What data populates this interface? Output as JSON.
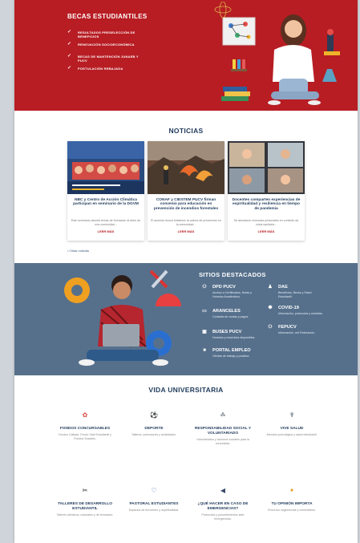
{
  "hero": {
    "title": "BECAS ESTUDIANTILES",
    "items": [
      "RESULTADOS PRESELECCIÓN DE BENEFICIOS",
      "RENOVACIÓN SOCIOECONÓMICA",
      "BECAS DE MANTENCIÓN JUNAEB Y PUCV",
      "POSTULACIÓN REBAJADA"
    ],
    "check_icon": "check-icon"
  },
  "news": {
    "title": "NOTICIAS",
    "cards": [
      {
        "title": "NBC y Centro de Acción Climática participan en seminario de la DGVM",
        "desc": "Este seminario abordó temas de formación al alero de una comunidad...",
        "more": "LEER MÁS"
      },
      {
        "title": "CONAF y CIESTEM PUCV firman convenio para educación en prevención de incendios forestales",
        "desc": "El acuerdo busca fortalecer la cultura de prevención en la comunidad...",
        "more": "LEER MÁS"
      },
      {
        "title": "Docentes comparten experiencias de espiritualidad y resiliencia en tiempo de pandemia",
        "desc": "Se abordaron vivencias personales en contexto de crisis sanitaria...",
        "more": "LEER MÁS"
      }
    ],
    "all_link": "• Otras noticias"
  },
  "sitios": {
    "title": "SITIOS DESTACADOS",
    "left": [
      {
        "icon": "users-icon",
        "label": "DPD PUCV",
        "desc": "Acceso a Certificados, Notas y Horarios Académicos."
      },
      {
        "icon": "card-icon",
        "label": "ARANCELES",
        "desc": "Consulta de cuotas y pagos."
      },
      {
        "icon": "bus-icon",
        "label": "BUSES PUCV",
        "desc": "Horarios y recorridos disponibles."
      },
      {
        "icon": "briefcase-icon",
        "label": "PORTAL EMPLEO",
        "desc": "Ofertas de trabajo y práctica."
      }
    ],
    "right": [
      {
        "icon": "user-icon",
        "label": "DAE",
        "desc": "Beneficios, Becas y Salud Estudiantil."
      },
      {
        "icon": "virus-icon",
        "label": "COVID-19",
        "desc": "Información, protocolos y medidas."
      },
      {
        "icon": "group-icon",
        "label": "FEPUCV",
        "desc": "Información, red Federación."
      }
    ]
  },
  "vida": {
    "title": "VIDA UNIVERSITARIA",
    "items": [
      {
        "icon": "trophy-icon",
        "glyph": "✿",
        "color": "#d8453f",
        "title": "FONDOS CONCURSABLES",
        "desc": "Fondos Calidad, Fondo Vida Estudiantil y Fondos Sociales."
      },
      {
        "icon": "football-icon",
        "glyph": "⚽",
        "color": "#3a6fb7",
        "title": "DEPORTE",
        "desc": "Talleres, selecciones y actividades."
      },
      {
        "icon": "hands-icon",
        "glyph": "☘",
        "color": "#8a8f97",
        "title": "RESPONSABILIDAD SOCIAL Y VOLUNTARIADO",
        "desc": "Voluntariados y acciones sociales para la comunidad."
      },
      {
        "icon": "health-icon",
        "glyph": "☤",
        "color": "#5b6672",
        "title": "VIVE SALUD",
        "desc": "Atención psicológica y salud estudiantil."
      },
      {
        "icon": "palette-icon",
        "glyph": "✂",
        "color": "#222222",
        "title": "TALLERES DE DESARROLLO ESTUDIANTIL",
        "desc": "Talleres artísticos, culturales y de formación."
      },
      {
        "icon": "pastoral-icon",
        "glyph": "♡",
        "color": "#3a6fb7",
        "title": "PASTORAL ESTUDIANTES",
        "desc": "Espacios de encuentro y espiritualidad."
      },
      {
        "icon": "emergency-icon",
        "glyph": "◀",
        "color": "#3a4a6b",
        "title": "¿QUÉ HACER EN CASO DE EMERGENCIAS?",
        "desc": "Protocolos y procedimientos ante emergencias."
      },
      {
        "icon": "lightbulb-icon",
        "glyph": "✦",
        "color": "#e5a025",
        "title": "TU OPINIÓN IMPORTA",
        "desc": "Envía tus sugerencias y comentarios."
      }
    ]
  }
}
